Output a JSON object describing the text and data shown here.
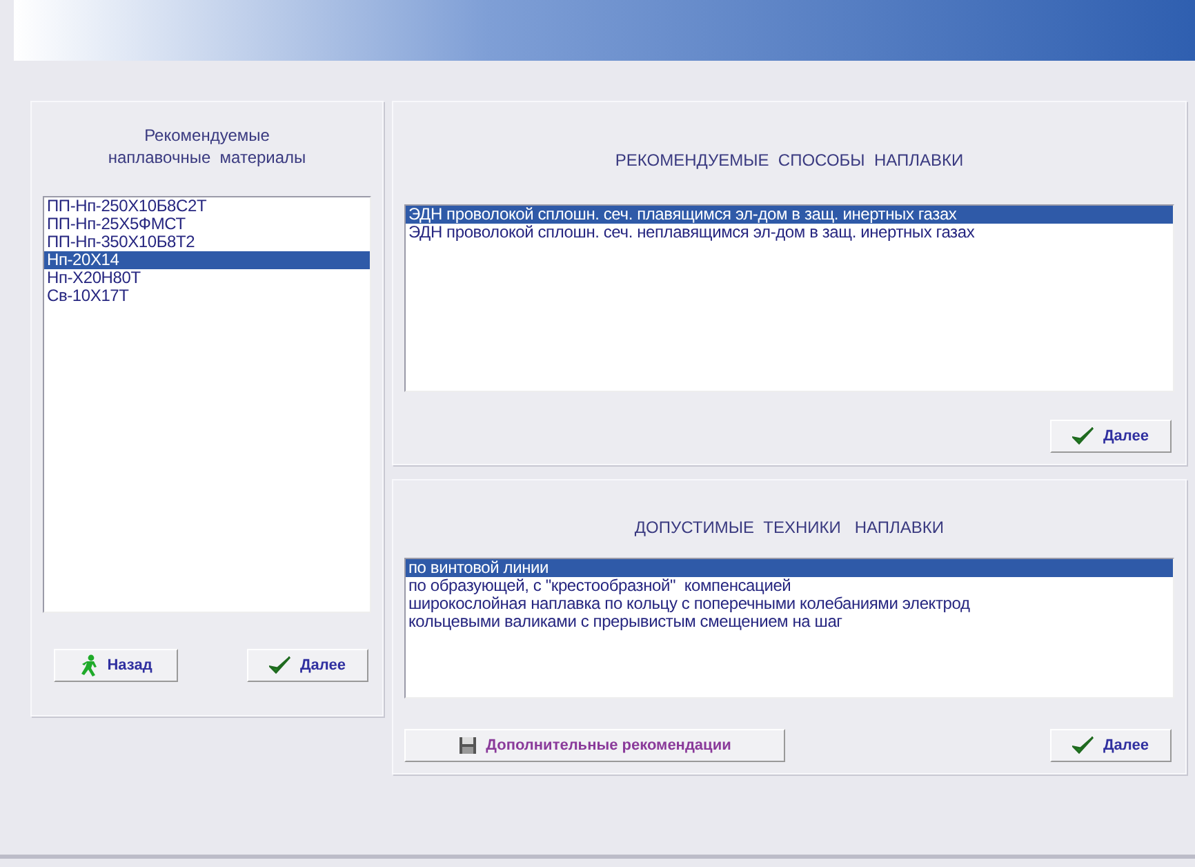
{
  "materials_panel": {
    "title_lines": [
      "Рекомендуемые",
      "наплавочные  материалы"
    ],
    "items": [
      {
        "label": "ПП-Нп-250Х10Б8С2Т",
        "selected": false
      },
      {
        "label": "ПП-Нп-25Х5ФМСТ",
        "selected": false
      },
      {
        "label": "ПП-Нп-350Х10Б8Т2",
        "selected": false
      },
      {
        "label": "Нп-20Х14",
        "selected": true
      },
      {
        "label": "Нп-Х20Н80Т",
        "selected": false
      },
      {
        "label": "Св-10Х17Т",
        "selected": false
      }
    ],
    "buttons": [
      {
        "label": "Назад",
        "kind": "back"
      },
      {
        "label": "Далее",
        "kind": "next"
      }
    ]
  },
  "methods_panel": {
    "title": "РЕКОМЕНДУЕМЫЕ  СПОСОБЫ  НАПЛАВКИ",
    "items": [
      {
        "label": "ЭДН проволокой сплошн. сеч. плавящимся эл-дом в защ. инертных газах",
        "selected": true
      },
      {
        "label": "ЭДН проволокой сплошн. сеч. неплавящимся эл-дом в защ. инертных газах",
        "selected": false
      }
    ],
    "buttons": [
      {
        "label": "Далее",
        "kind": "next"
      }
    ]
  },
  "techniques_panel": {
    "title": "ДОПУСТИМЫЕ  ТЕХНИКИ   НАПЛАВКИ",
    "items": [
      {
        "label": "по винтовой линии",
        "selected": true
      },
      {
        "label": "по образующей, с \"крестообразной\"  компенсацией",
        "selected": false
      },
      {
        "label": "широкослойная наплавка по кольцу с поперечными колебаниями электрод",
        "selected": false
      },
      {
        "label": "кольцевыми валиками с прерывистым смещением на шаг",
        "selected": false
      }
    ],
    "buttons": [
      {
        "label": "Дополнительные рекомендации",
        "kind": "extra"
      },
      {
        "label": "Далее",
        "kind": "next"
      }
    ]
  }
}
